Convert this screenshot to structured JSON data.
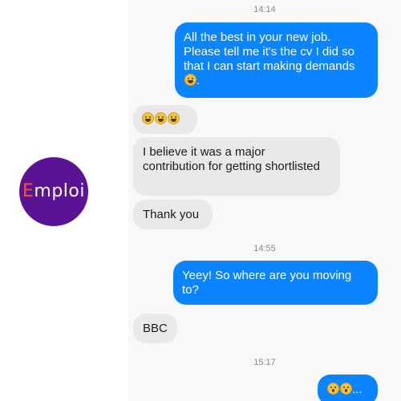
{
  "brand": {
    "logo_first": "E",
    "logo_rest": "mploi",
    "accent": "#5b1396",
    "logo_letter_color": "#f0562f"
  },
  "colors": {
    "outgoing_bubble": "#0a84ff",
    "incoming_bubble": "#e9e9eb",
    "chat_bg": "#f8f8f8"
  },
  "timestamps": [
    "14:14",
    "14:55",
    "15:17"
  ],
  "messages": [
    {
      "direction": "outgoing",
      "text_a": "All the best in your new job. Please tell me it's the cv I did so that I can start making demands",
      "text_b": "."
    },
    {
      "direction": "incoming",
      "emoji": [
        "grin-sweat",
        "grin-sweat",
        "grin-sweat"
      ]
    },
    {
      "direction": "incoming",
      "text": "I believe it was a major contribution for getting shortlisted"
    },
    {
      "direction": "incoming",
      "text": "Thank you"
    },
    {
      "direction": "outgoing",
      "text": "Yeey! So where are you moving to?"
    },
    {
      "direction": "incoming",
      "text": "BBC"
    },
    {
      "direction": "outgoing",
      "emoji": [
        "astonished",
        "astonished"
      ],
      "text": "..."
    }
  ]
}
